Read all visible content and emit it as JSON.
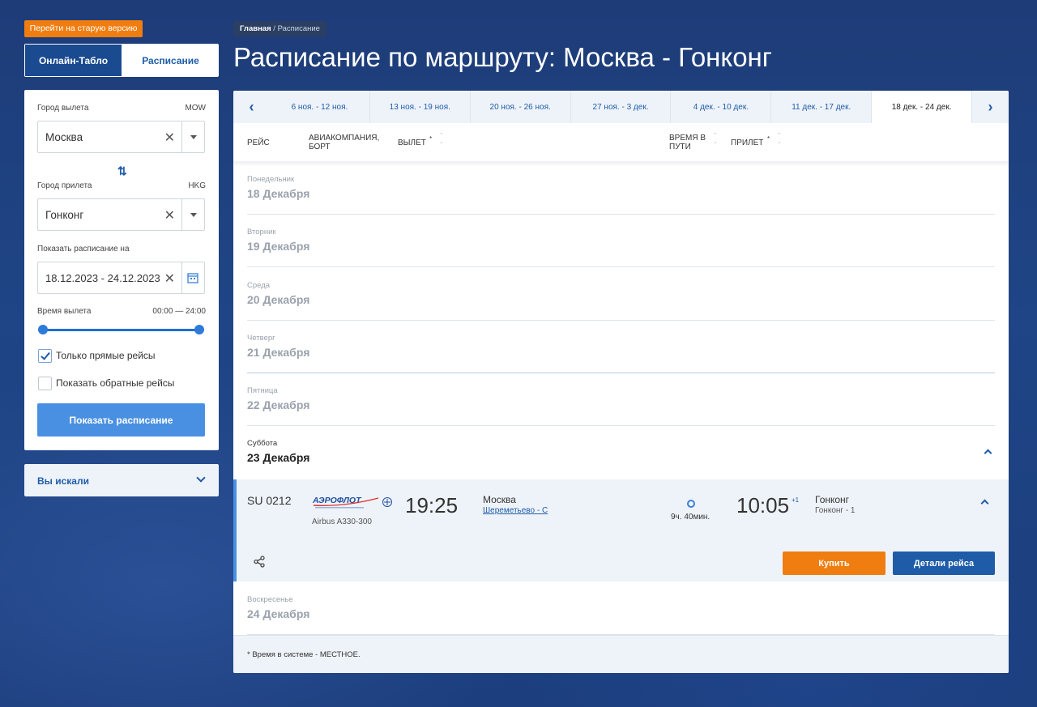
{
  "sidebar": {
    "old_version": "Перейти на старую версию",
    "tabs": [
      "Онлайн-Табло",
      "Расписание"
    ],
    "from": {
      "label": "Город вылета",
      "code": "MOW",
      "value": "Москва"
    },
    "to": {
      "label": "Город прилета",
      "code": "HKG",
      "value": "Гонконг"
    },
    "dates": {
      "label": "Показать расписание на",
      "value": "18.12.2023 - 24.12.2023"
    },
    "time": {
      "label": "Время вылета",
      "range": "00:00 — 24:00",
      "min_fraction": 0,
      "max_fraction": 1
    },
    "direct": {
      "label": "Только прямые рейсы",
      "checked": true
    },
    "return": {
      "label": "Показать обратные рейсы",
      "checked": false
    },
    "show_button": "Показать расписание",
    "searched": "Вы искали"
  },
  "breadcrumb": {
    "home": "Главная",
    "sep": "/",
    "current": "Расписание"
  },
  "title": "Расписание по маршруту: Москва - Гонконг",
  "weeks": [
    "6 ноя. - 12 ноя.",
    "13 ноя. - 19 ноя.",
    "20 ноя. - 26 ноя.",
    "27 ноя. - 3 дек.",
    "4 дек. - 10 дек.",
    "11 дек. - 17 дек.",
    "18 дек. - 24 дек."
  ],
  "columns": {
    "flight": "РЕЙС",
    "airline": "АВИАКОМПАНИЯ, БОРТ",
    "departure": "ВЫЛЕТ",
    "duration": "ВРЕМЯ В ПУТИ",
    "arrival": "ПРИЛЕТ",
    "star": "*"
  },
  "days": [
    {
      "name": "Понедельник",
      "date": "18 Декабря"
    },
    {
      "name": "Вторник",
      "date": "19 Декабря"
    },
    {
      "name": "Среда",
      "date": "20 Декабря"
    },
    {
      "name": "Четверг",
      "date": "21 Декабря"
    },
    {
      "name": "Пятница",
      "date": "22 Декабря"
    },
    {
      "name": "Суббота",
      "date": "23 Декабря"
    },
    {
      "name": "Воскресенье",
      "date": "24 Декабря"
    }
  ],
  "flight": {
    "number": "SU 0212",
    "airline_logo": "АЭРОФЛОТ",
    "aircraft": "Airbus A330-300",
    "dep_time": "19:25",
    "dep_city": "Москва",
    "dep_airport": "Шереметьево - С",
    "duration": "9ч. 40мин.",
    "arr_time": "10:05",
    "arr_plus": "+1",
    "arr_city": "Гонконг",
    "arr_airport": "Гонконг - 1",
    "buy": "Купить",
    "details": "Детали рейса"
  },
  "footnote": "* Время в системе - МЕСТНОЕ."
}
